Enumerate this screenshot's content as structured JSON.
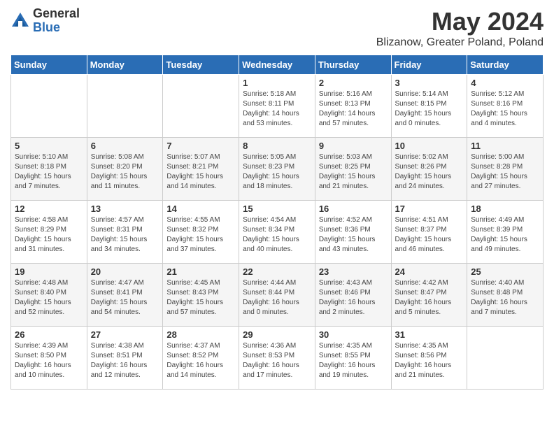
{
  "logo": {
    "general": "General",
    "blue": "Blue"
  },
  "title": "May 2024",
  "subtitle": "Blizanow, Greater Poland, Poland",
  "days_header": [
    "Sunday",
    "Monday",
    "Tuesday",
    "Wednesday",
    "Thursday",
    "Friday",
    "Saturday"
  ],
  "weeks": [
    [
      {
        "num": "",
        "info": ""
      },
      {
        "num": "",
        "info": ""
      },
      {
        "num": "",
        "info": ""
      },
      {
        "num": "1",
        "info": "Sunrise: 5:18 AM\nSunset: 8:11 PM\nDaylight: 14 hours\nand 53 minutes."
      },
      {
        "num": "2",
        "info": "Sunrise: 5:16 AM\nSunset: 8:13 PM\nDaylight: 14 hours\nand 57 minutes."
      },
      {
        "num": "3",
        "info": "Sunrise: 5:14 AM\nSunset: 8:15 PM\nDaylight: 15 hours\nand 0 minutes."
      },
      {
        "num": "4",
        "info": "Sunrise: 5:12 AM\nSunset: 8:16 PM\nDaylight: 15 hours\nand 4 minutes."
      }
    ],
    [
      {
        "num": "5",
        "info": "Sunrise: 5:10 AM\nSunset: 8:18 PM\nDaylight: 15 hours\nand 7 minutes."
      },
      {
        "num": "6",
        "info": "Sunrise: 5:08 AM\nSunset: 8:20 PM\nDaylight: 15 hours\nand 11 minutes."
      },
      {
        "num": "7",
        "info": "Sunrise: 5:07 AM\nSunset: 8:21 PM\nDaylight: 15 hours\nand 14 minutes."
      },
      {
        "num": "8",
        "info": "Sunrise: 5:05 AM\nSunset: 8:23 PM\nDaylight: 15 hours\nand 18 minutes."
      },
      {
        "num": "9",
        "info": "Sunrise: 5:03 AM\nSunset: 8:25 PM\nDaylight: 15 hours\nand 21 minutes."
      },
      {
        "num": "10",
        "info": "Sunrise: 5:02 AM\nSunset: 8:26 PM\nDaylight: 15 hours\nand 24 minutes."
      },
      {
        "num": "11",
        "info": "Sunrise: 5:00 AM\nSunset: 8:28 PM\nDaylight: 15 hours\nand 27 minutes."
      }
    ],
    [
      {
        "num": "12",
        "info": "Sunrise: 4:58 AM\nSunset: 8:29 PM\nDaylight: 15 hours\nand 31 minutes."
      },
      {
        "num": "13",
        "info": "Sunrise: 4:57 AM\nSunset: 8:31 PM\nDaylight: 15 hours\nand 34 minutes."
      },
      {
        "num": "14",
        "info": "Sunrise: 4:55 AM\nSunset: 8:32 PM\nDaylight: 15 hours\nand 37 minutes."
      },
      {
        "num": "15",
        "info": "Sunrise: 4:54 AM\nSunset: 8:34 PM\nDaylight: 15 hours\nand 40 minutes."
      },
      {
        "num": "16",
        "info": "Sunrise: 4:52 AM\nSunset: 8:36 PM\nDaylight: 15 hours\nand 43 minutes."
      },
      {
        "num": "17",
        "info": "Sunrise: 4:51 AM\nSunset: 8:37 PM\nDaylight: 15 hours\nand 46 minutes."
      },
      {
        "num": "18",
        "info": "Sunrise: 4:49 AM\nSunset: 8:39 PM\nDaylight: 15 hours\nand 49 minutes."
      }
    ],
    [
      {
        "num": "19",
        "info": "Sunrise: 4:48 AM\nSunset: 8:40 PM\nDaylight: 15 hours\nand 52 minutes."
      },
      {
        "num": "20",
        "info": "Sunrise: 4:47 AM\nSunset: 8:41 PM\nDaylight: 15 hours\nand 54 minutes."
      },
      {
        "num": "21",
        "info": "Sunrise: 4:45 AM\nSunset: 8:43 PM\nDaylight: 15 hours\nand 57 minutes."
      },
      {
        "num": "22",
        "info": "Sunrise: 4:44 AM\nSunset: 8:44 PM\nDaylight: 16 hours\nand 0 minutes."
      },
      {
        "num": "23",
        "info": "Sunrise: 4:43 AM\nSunset: 8:46 PM\nDaylight: 16 hours\nand 2 minutes."
      },
      {
        "num": "24",
        "info": "Sunrise: 4:42 AM\nSunset: 8:47 PM\nDaylight: 16 hours\nand 5 minutes."
      },
      {
        "num": "25",
        "info": "Sunrise: 4:40 AM\nSunset: 8:48 PM\nDaylight: 16 hours\nand 7 minutes."
      }
    ],
    [
      {
        "num": "26",
        "info": "Sunrise: 4:39 AM\nSunset: 8:50 PM\nDaylight: 16 hours\nand 10 minutes."
      },
      {
        "num": "27",
        "info": "Sunrise: 4:38 AM\nSunset: 8:51 PM\nDaylight: 16 hours\nand 12 minutes."
      },
      {
        "num": "28",
        "info": "Sunrise: 4:37 AM\nSunset: 8:52 PM\nDaylight: 16 hours\nand 14 minutes."
      },
      {
        "num": "29",
        "info": "Sunrise: 4:36 AM\nSunset: 8:53 PM\nDaylight: 16 hours\nand 17 minutes."
      },
      {
        "num": "30",
        "info": "Sunrise: 4:35 AM\nSunset: 8:55 PM\nDaylight: 16 hours\nand 19 minutes."
      },
      {
        "num": "31",
        "info": "Sunrise: 4:35 AM\nSunset: 8:56 PM\nDaylight: 16 hours\nand 21 minutes."
      },
      {
        "num": "",
        "info": ""
      }
    ]
  ]
}
